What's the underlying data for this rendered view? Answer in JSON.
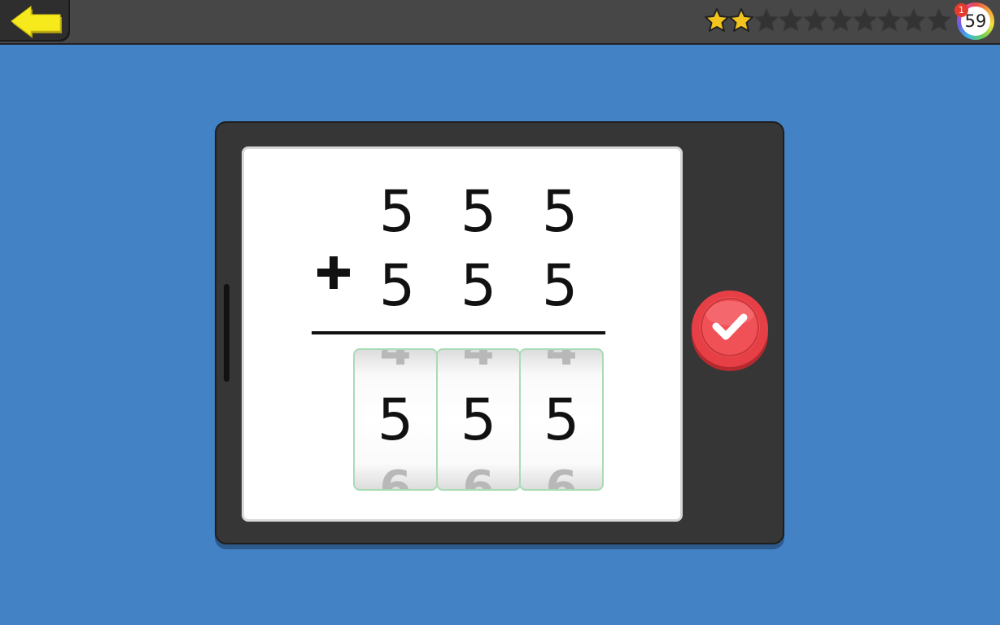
{
  "toolbar": {
    "back_icon": "left-arrow-icon",
    "stars_total": 10,
    "stars_earned": 2,
    "star_color_earned": "#f2c41d",
    "star_color_empty": "#333333",
    "level_badge": "59",
    "notification_count": "1"
  },
  "problem": {
    "operator": "+",
    "addend1": [
      "5",
      "5",
      "5"
    ],
    "addend2": [
      "5",
      "5",
      "5"
    ]
  },
  "answer_reels": [
    {
      "prev": "4",
      "current": "5",
      "next": "6"
    },
    {
      "prev": "4",
      "current": "5",
      "next": "6"
    },
    {
      "prev": "4",
      "current": "5",
      "next": "6"
    }
  ],
  "submit": {
    "icon": "checkmark-icon",
    "color": "#e0383d"
  },
  "colors": {
    "background": "#4482c6",
    "tablet": "#363636",
    "reel_border": "#a8dcb4"
  }
}
